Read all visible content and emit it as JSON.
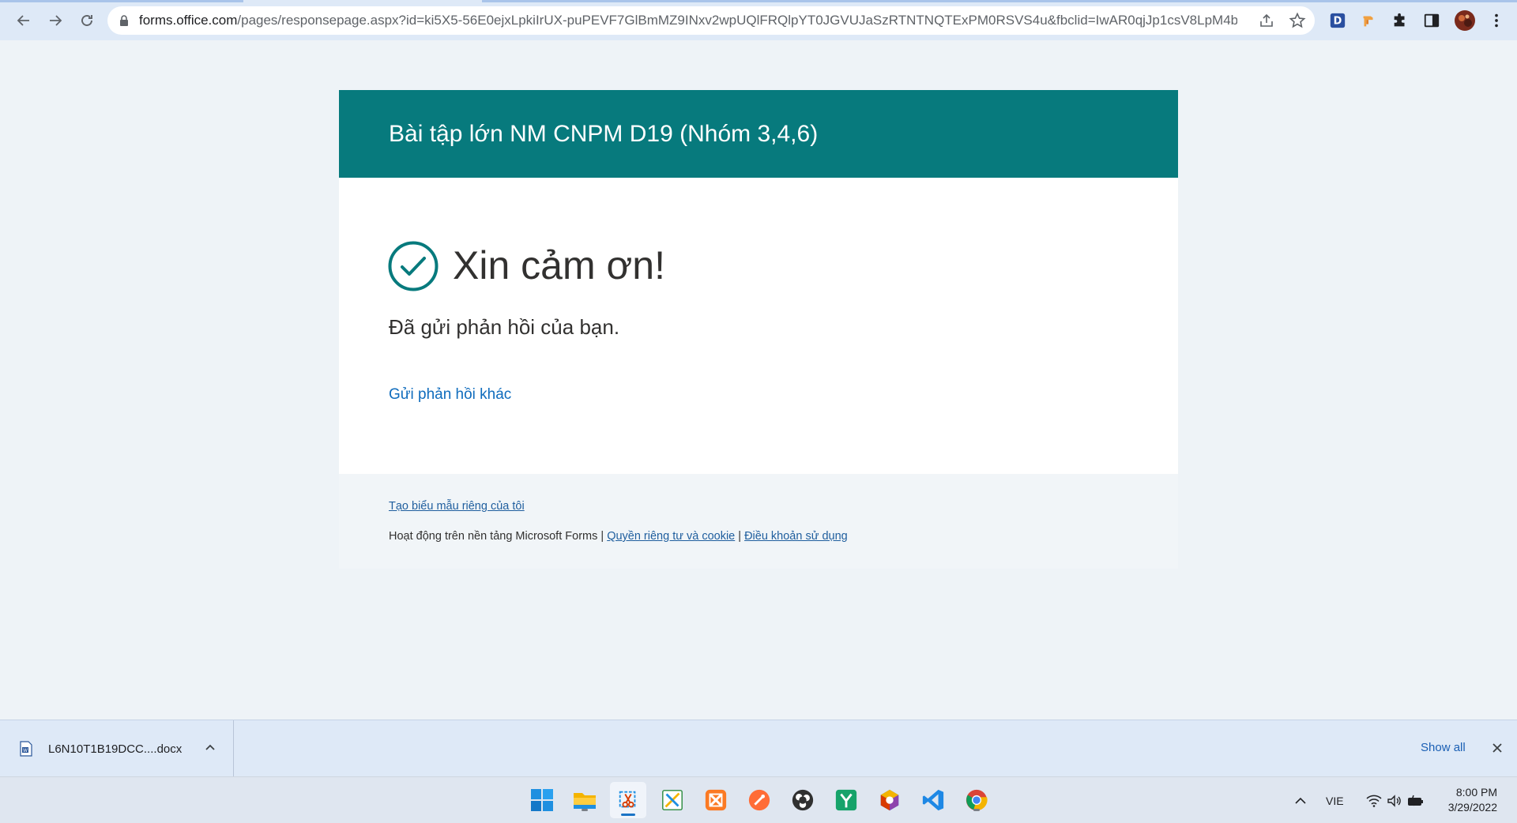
{
  "browser": {
    "url_host": "forms.office.com",
    "url_path": "/pages/responsepage.aspx?id=ki5X5-56E0ejxLpkiIrUX-puPEVF7GlBmMZ9INxv2wpUQlFRQlpYT0JGVUJaSzRTNTNQTExPM0RSVS4u&fbclid=IwAR0qjJp1csV8LpM4bS..."
  },
  "form": {
    "title": "Bài tập lớn NM CNPM D19 (Nhóm 3,4,6)",
    "thanks": "Xin cảm ơn!",
    "submitted_message": "Đã gửi phản hồi của bạn.",
    "another_response_link": "Gửi phản hồi khác"
  },
  "footer": {
    "create_own_link": "Tạo biểu mẫu riêng của tôi",
    "powered_by": "Hoạt động trên nền tảng Microsoft Forms |",
    "privacy_link": "Quyền riêng tư và cookie",
    "separator": "|",
    "terms_link": "Điều khoản sử dụng"
  },
  "downloads": {
    "file_name": "L6N10T1B19DCC....docx",
    "show_all": "Show all"
  },
  "taskbar": {
    "language": "VIE",
    "time": "8:00 PM",
    "date": "3/29/2022"
  },
  "colors": {
    "header_teal": "#077a7d",
    "link_blue": "#0f6cbd"
  }
}
